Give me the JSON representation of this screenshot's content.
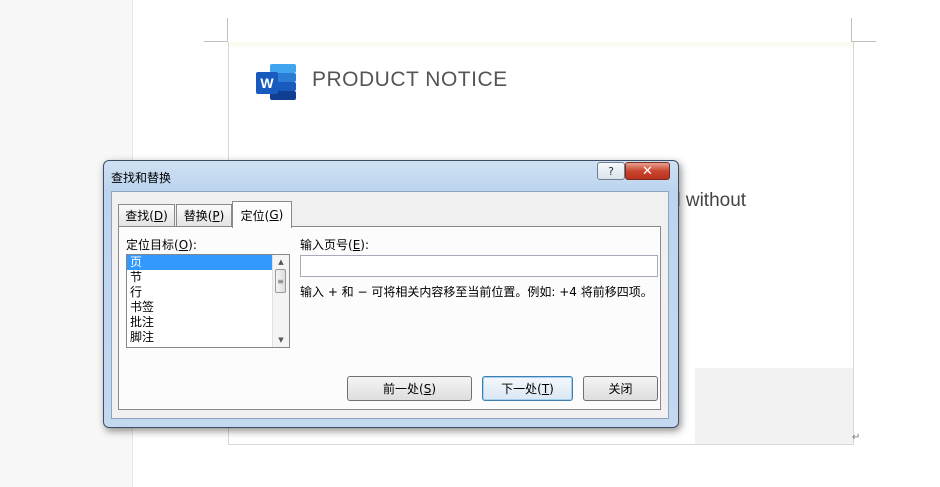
{
  "document": {
    "title": "PRODUCT NOTICE",
    "logo_letter": "W",
    "partial_text": "d without",
    "partial_text_2": "·",
    "paragraph_mark": "↵"
  },
  "dialog": {
    "title": "查找和替换",
    "help_label": "?",
    "close_label": "✕",
    "tabs": [
      {
        "label": "查找(",
        "key": "D",
        "suffix": ")"
      },
      {
        "label": "替换(",
        "key": "P",
        "suffix": ")"
      },
      {
        "label": "定位(",
        "key": "G",
        "suffix": ")"
      }
    ],
    "goto_label": {
      "text": "定位目标(",
      "key": "O",
      "suffix": "):"
    },
    "goto_items": [
      "页",
      "节",
      "行",
      "书签",
      "批注",
      "脚注"
    ],
    "page_label": {
      "text": "输入页号(",
      "key": "E",
      "suffix": "):"
    },
    "page_input_value": "",
    "hint": "输入 + 和 − 可将相关内容移至当前位置。例如: +4 将前移四项。",
    "buttons": {
      "prev": {
        "text": "前一处(",
        "key": "S",
        "suffix": ")"
      },
      "next": {
        "text": "下一处(",
        "key": "T",
        "suffix": ")"
      },
      "close": "关闭"
    }
  },
  "colors": {
    "selection": "#3399ff",
    "word_blue": "#185abd",
    "title_text": "#555555"
  }
}
